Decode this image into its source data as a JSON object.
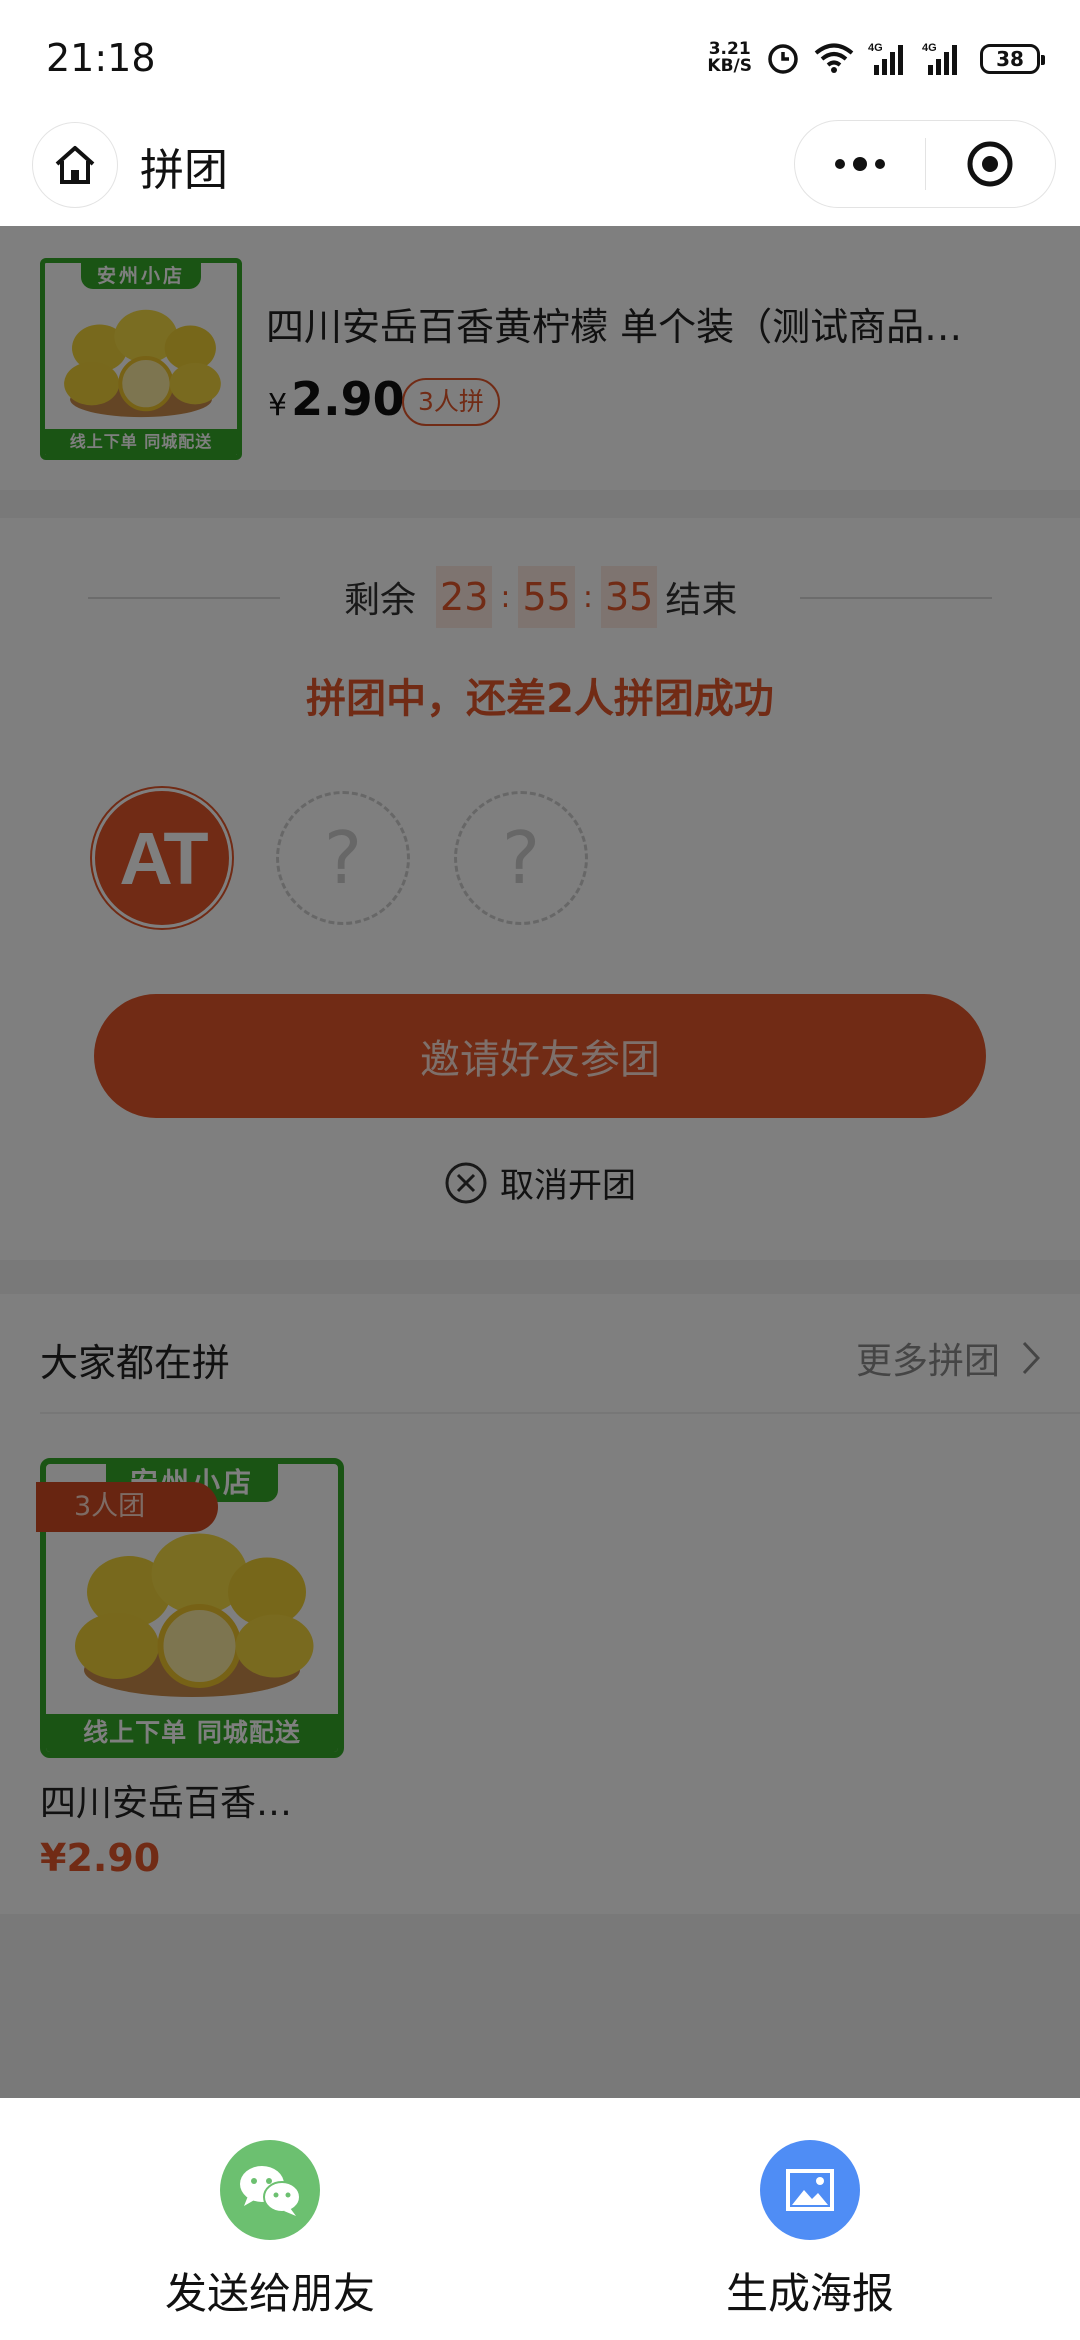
{
  "status_bar": {
    "time": "21:18",
    "net_speed_value": "3.21",
    "net_speed_unit": "KB/S",
    "network_label_1": "4G",
    "network_label_2": "4G",
    "battery": "38"
  },
  "nav": {
    "title": "拼团",
    "home_icon": "home-icon",
    "more_icon": "more-dots-icon",
    "close_icon": "target-close-icon"
  },
  "product": {
    "store_banner": "安州小店",
    "store_footer": "线上下单 同城配送",
    "name": "四川安岳百香黄柠檬 单个装（测试商品…",
    "currency": "¥",
    "price": "2.90",
    "group_tag": "3人拼"
  },
  "group": {
    "timer_prefix": "剩余",
    "hours": "23",
    "minutes": "55",
    "seconds": "35",
    "timer_suffix": "结束",
    "status": "拼团中，还差2人拼团成功",
    "member_avatar_text": "AT",
    "empty_slot_symbol": "?",
    "invite_button": "邀请好友参团",
    "cancel_label": "取消开团"
  },
  "others": {
    "title": "大家都在拼",
    "more_label": "更多拼团",
    "items": [
      {
        "badge": "3人团",
        "store_banner": "安州小店",
        "store_footer": "线上下单 同城配送",
        "name": "四川安岳百香…",
        "price": "¥2.90"
      }
    ]
  },
  "share": {
    "friend_label": "发送给朋友",
    "poster_label": "生成海报"
  },
  "colors": {
    "accent": "#e2572b",
    "store_green": "#35a829",
    "wechat_green": "#6cc070",
    "poster_blue": "#4f8df5"
  }
}
